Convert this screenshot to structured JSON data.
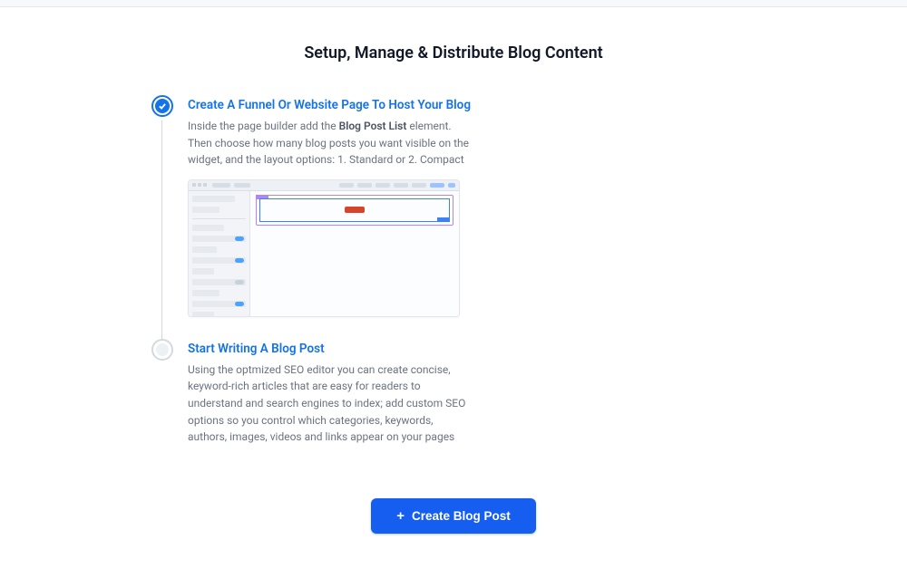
{
  "page": {
    "title": "Setup, Manage & Distribute Blog Content"
  },
  "steps": [
    {
      "title": "Create A Funnel Or Website Page To Host Your Blog",
      "desc_pre": "Inside the page builder add the ",
      "desc_bold": "Blog Post List",
      "desc_post": " element. Then choose how many blog posts you want visible on the widget, and the layout options: 1. Standard or 2. Compact",
      "status": "done"
    },
    {
      "title": "Start Writing A Blog Post",
      "desc": "Using the optmized SEO editor you can create concise, keyword-rich articles that are easy for readers to understand and search engines to index; add custom SEO options so you control which categories, keywords, authors, images, videos and links appear on your pages",
      "status": "pending"
    }
  ],
  "cta": {
    "plus": "+",
    "label": "Create Blog Post"
  }
}
